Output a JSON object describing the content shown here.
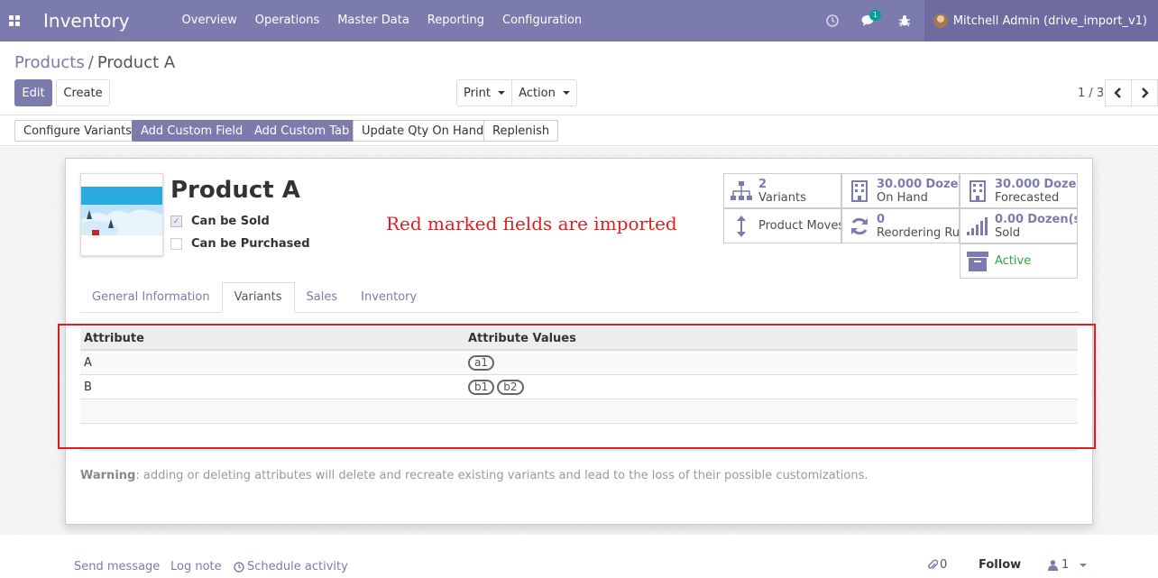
{
  "navbar": {
    "brand": "Inventory",
    "menu": [
      "Overview",
      "Operations",
      "Master Data",
      "Reporting",
      "Configuration"
    ],
    "messages_badge": "1",
    "user": "Mitchell Admin (drive_import_v1)"
  },
  "breadcrumb": {
    "parent": "Products",
    "separator": "/",
    "current": "Product A"
  },
  "control": {
    "edit": "Edit",
    "create": "Create",
    "print": "Print",
    "action": "Action",
    "pager": "1 / 3"
  },
  "statusbar": {
    "buttons": [
      "Configure Variants",
      "Add Custom Field",
      "Add Custom Tab",
      "Update Qty On Hand",
      "Replenish"
    ]
  },
  "product": {
    "name": "Product A",
    "can_be_sold": {
      "label": "Can be Sold",
      "checked": true
    },
    "can_be_purchased": {
      "label": "Can be Purchased",
      "checked": false
    }
  },
  "note": "Red marked fields are imported",
  "smart_buttons": {
    "variants": {
      "value": "2",
      "label": "Variants",
      "icon": "sitemap-icon"
    },
    "on_hand": {
      "value": "30.000",
      "unit": "Dozen(s)",
      "label": "On Hand",
      "icon": "building-icon"
    },
    "forecasted": {
      "value": "30.000",
      "unit": "Dozen(s)",
      "label": "Forecasted",
      "icon": "building-icon"
    },
    "product_moves": {
      "label": "Product Moves",
      "icon": "arrows-v-icon"
    },
    "reordering": {
      "value": "0",
      "label": "Reordering Rules",
      "icon": "refresh-icon"
    },
    "sold": {
      "value": "0.00",
      "unit": "Dozen(s)",
      "label": "Sold",
      "icon": "signal-icon"
    },
    "active": {
      "label": "Active",
      "icon": "archive-icon",
      "color": "#28a745"
    }
  },
  "tabs": [
    "General Information",
    "Variants",
    "Sales",
    "Inventory"
  ],
  "variants_table": {
    "headers": [
      "Attribute",
      "Attribute Values"
    ],
    "rows": [
      {
        "attribute": "A",
        "values": [
          "a1"
        ]
      },
      {
        "attribute": "B",
        "values": [
          "b1",
          "b2"
        ]
      }
    ]
  },
  "warning": {
    "bold": "Warning",
    "text": ": adding or deleting attributes will delete and recreate existing variants and lead to the loss of their possible customizations."
  },
  "chatter": {
    "send_message": "Send message",
    "log_note": "Log note",
    "schedule_activity": "Schedule activity",
    "attachments": "0",
    "follow": "Follow",
    "followers": "1"
  },
  "colors": {
    "brand": "#7c7bad",
    "highlight": "#e01b24",
    "active": "#28a745"
  }
}
